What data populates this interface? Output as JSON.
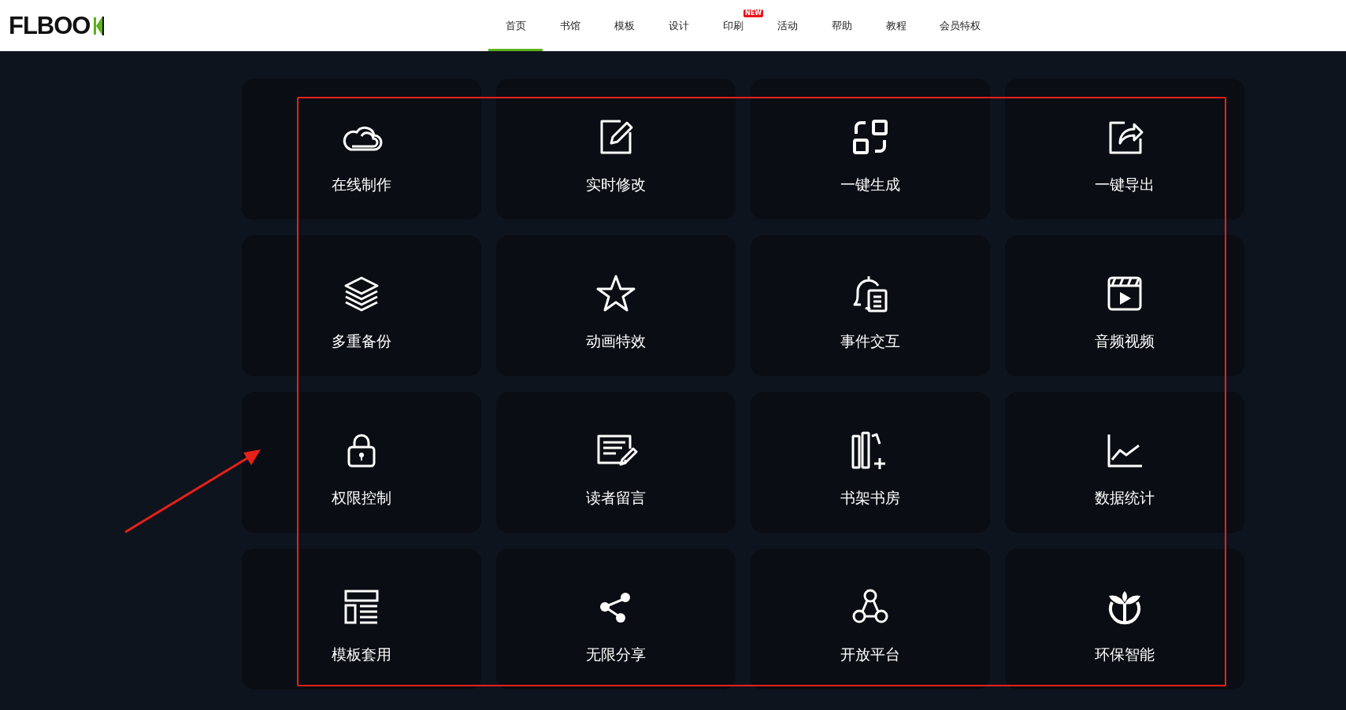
{
  "header": {
    "logo": "FLBOO",
    "nav": [
      {
        "label": "首页",
        "selected": true
      },
      {
        "label": "书馆",
        "selected": false
      },
      {
        "label": "模板",
        "selected": false
      },
      {
        "label": "设计",
        "selected": false
      },
      {
        "label": "印刷",
        "selected": false,
        "badge": "NEW"
      },
      {
        "label": "活动",
        "selected": false
      },
      {
        "label": "帮助",
        "selected": false
      },
      {
        "label": "教程",
        "selected": false
      },
      {
        "label": "会员特权",
        "selected": false
      }
    ]
  },
  "features": [
    {
      "label": "在线制作"
    },
    {
      "label": "实时修改"
    },
    {
      "label": "一键生成"
    },
    {
      "label": "一键导出"
    },
    {
      "label": "多重备份"
    },
    {
      "label": "动画特效"
    },
    {
      "label": "事件交互"
    },
    {
      "label": "音频视频"
    },
    {
      "label": "权限控制"
    },
    {
      "label": "读者留言"
    },
    {
      "label": "书架书房"
    },
    {
      "label": "数据统计"
    },
    {
      "label": "模板套用"
    },
    {
      "label": "无限分享"
    },
    {
      "label": "开放平台"
    },
    {
      "label": "环保智能"
    }
  ]
}
